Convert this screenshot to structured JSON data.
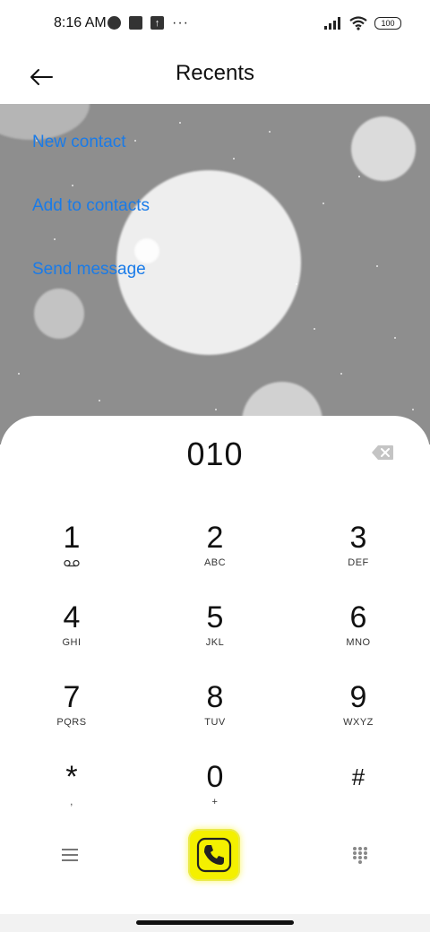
{
  "status_bar": {
    "time": "8:16 AM",
    "battery": "100",
    "icons": [
      "circle-status-icon",
      "square-status-icon",
      "upload-status-icon",
      "more-dots-icon",
      "signal-icon",
      "wifi-icon",
      "battery-icon"
    ]
  },
  "header": {
    "title": "Recents",
    "back_icon": "arrow-left-icon"
  },
  "menu": {
    "new_contact": "New contact",
    "add_to_contacts": "Add to contacts",
    "send_message": "Send message"
  },
  "dialer": {
    "number": "010",
    "keys": [
      {
        "digit": "1",
        "letters": ""
      },
      {
        "digit": "2",
        "letters": "ABC"
      },
      {
        "digit": "3",
        "letters": "DEF"
      },
      {
        "digit": "4",
        "letters": "GHI"
      },
      {
        "digit": "5",
        "letters": "JKL"
      },
      {
        "digit": "6",
        "letters": "MNO"
      },
      {
        "digit": "7",
        "letters": "PQRS"
      },
      {
        "digit": "8",
        "letters": "TUV"
      },
      {
        "digit": "9",
        "letters": "WXYZ"
      },
      {
        "digit": "*",
        "letters": ","
      },
      {
        "digit": "0",
        "letters": "+"
      },
      {
        "digit": "#",
        "letters": ""
      }
    ]
  },
  "colors": {
    "link": "#1a7be8",
    "call_button": "#f4f000",
    "background_overlay": "#8e8e8e"
  }
}
